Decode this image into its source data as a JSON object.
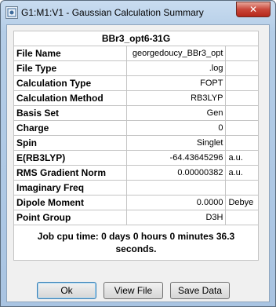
{
  "window": {
    "title": "G1:M1:V1 - Gaussian Calculation Summary",
    "close_label": "✕"
  },
  "summary": {
    "header": "BBr3_opt6-31G",
    "rows": [
      {
        "label": "File Name",
        "value": "georgedoucy_BBr3_opt",
        "unit": ""
      },
      {
        "label": "File Type",
        "value": ".log",
        "unit": ""
      },
      {
        "label": "Calculation Type",
        "value": "FOPT",
        "unit": ""
      },
      {
        "label": "Calculation Method",
        "value": "RB3LYP",
        "unit": ""
      },
      {
        "label": "Basis Set",
        "value": "Gen",
        "unit": ""
      },
      {
        "label": "Charge",
        "value": "0",
        "unit": ""
      },
      {
        "label": "Spin",
        "value": "Singlet",
        "unit": ""
      },
      {
        "label": "E(RB3LYP)",
        "value": "-64.43645296",
        "unit": "a.u."
      },
      {
        "label": "RMS Gradient Norm",
        "value": "0.00000382",
        "unit": "a.u."
      },
      {
        "label": "Imaginary Freq",
        "value": "",
        "unit": ""
      },
      {
        "label": "Dipole Moment",
        "value": "0.0000",
        "unit": "Debye"
      },
      {
        "label": "Point Group",
        "value": "D3H",
        "unit": ""
      }
    ],
    "cpu_time": "Job cpu time:  0 days  0 hours  0 minutes 36.3 seconds."
  },
  "buttons": {
    "ok": "Ok",
    "view_file": "View File",
    "save_data": "Save Data"
  }
}
